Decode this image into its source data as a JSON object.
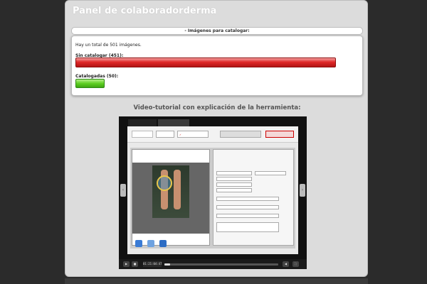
{
  "header": {
    "title": "Panel de colaboradorderma"
  },
  "images_section": {
    "heading": "- Imágenes para catalogar:",
    "total_text": "Hay un total de 501 imágenes.",
    "uncataloged_label": "Sin catalogar (451):",
    "uncataloged_count": 451,
    "cataloged_label": "Catalogadas (50):",
    "cataloged_count": 50,
    "total_count": 501
  },
  "video_section": {
    "title": "Video-tutorial con explicación de la herramienta:",
    "player": {
      "tabs": [
        "",
        ""
      ],
      "toolbar": {
        "left_box": "",
        "search_field": "",
        "search_button": "",
        "right_button": ""
      },
      "steps": [
        "",
        ""
      ],
      "right_pane_title": "",
      "field_values": [
        "",
        "",
        "",
        ""
      ],
      "current_time": "01:21:04:47",
      "progress": 0.05
    }
  },
  "colors": {
    "bar_red": "#d32020",
    "bar_green": "#4fbf1a"
  }
}
